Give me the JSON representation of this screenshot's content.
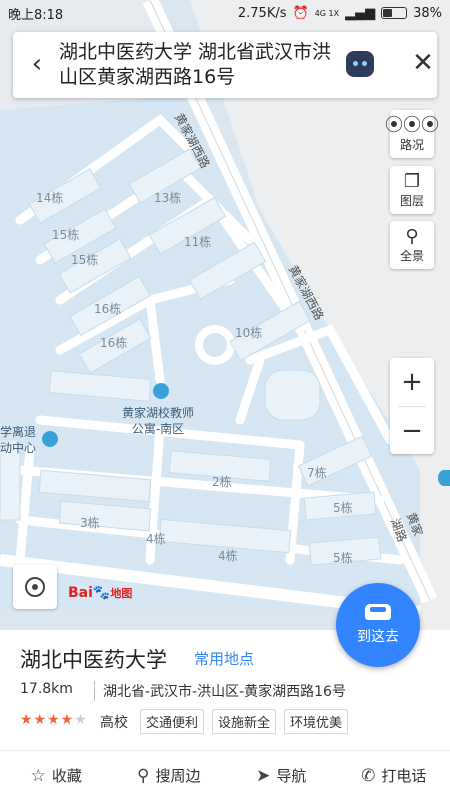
{
  "status_bar": {
    "time": "晚上8:18",
    "net_speed": "2.75K/s",
    "signal": "4G 1X",
    "battery": "38%"
  },
  "search": {
    "title": "湖北中医药大学 湖北省武汉市洪山区黄家湖西路16号"
  },
  "tools": {
    "traffic_label": "路况",
    "layers_label": "图层",
    "panorama_label": "全景",
    "zoom_in": "+",
    "zoom_out": "−"
  },
  "map": {
    "labels": {
      "b14": "14栋",
      "b13": "13栋",
      "b15a": "15栋",
      "b15b": "15栋",
      "b11": "11栋",
      "b16a": "16栋",
      "b16b": "16栋",
      "b10": "10栋",
      "b7": "7栋",
      "b2": "2栋",
      "b5a": "5栋",
      "b3": "3栋",
      "b4a": "4栋",
      "b4b": "4栋",
      "b5b": "5栋",
      "road1": "黄家湖西路",
      "road2": "黄家湖西路",
      "road3": "黄家湖路",
      "poi1_line1": "黄家湖校教师",
      "poi1_line2": "公寓-南区",
      "poi2_line1": "学离退",
      "poi2_line2": "动中心"
    }
  },
  "logo": {
    "text": "Bai",
    "suffix": "地图"
  },
  "go_button": {
    "label": "到这去"
  },
  "place": {
    "name": "湖北中医药大学",
    "tag": "常用地点",
    "distance": "17.8km",
    "address": "湖北省-武汉市-洪山区-黄家湖西路16号",
    "rating": 4,
    "stars_full": "★★★★",
    "stars_empty": "★",
    "category": "高校",
    "tags": [
      "交通便利",
      "设施新全",
      "环境优美"
    ]
  },
  "actions": [
    {
      "label": "收藏",
      "icon": "star-icon"
    },
    {
      "label": "搜周边",
      "icon": "location-pin-icon"
    },
    {
      "label": "导航",
      "icon": "navigation-arrow-icon"
    },
    {
      "label": "打电话",
      "icon": "phone-icon"
    }
  ]
}
